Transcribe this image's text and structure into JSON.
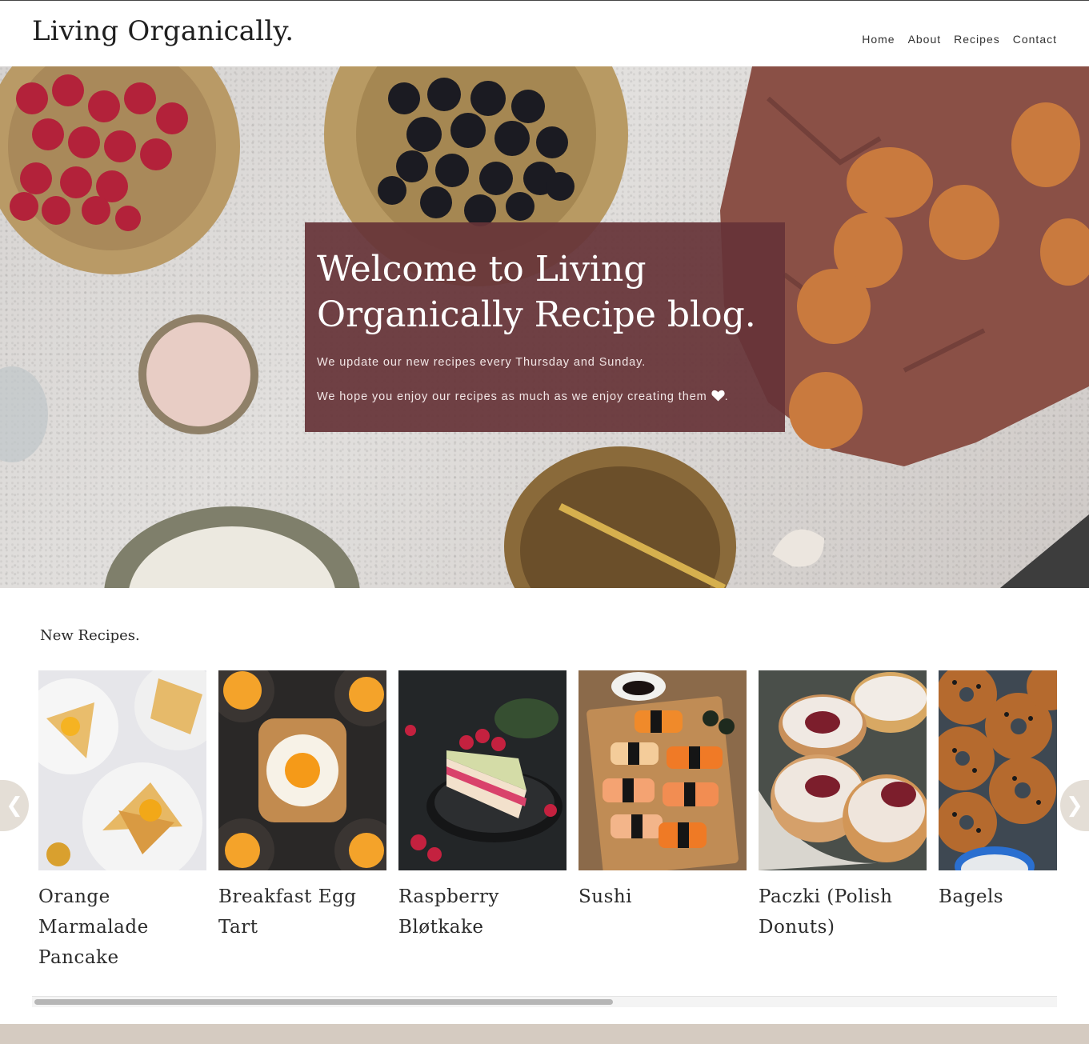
{
  "header": {
    "site_title": "Living Organically.",
    "nav": [
      "Home",
      "About",
      "Recipes",
      "Contact"
    ]
  },
  "hero": {
    "title": "Welcome to Living Organically Recipe blog.",
    "line1": "We update our new recipes every Thursday and Sunday.",
    "line2": "We hope you enjoy our recipes as much as we enjoy creating them",
    "line2_end": ".",
    "heart_icon": "heart-icon",
    "box_color": "#663438"
  },
  "recipes": {
    "title": "New Recipes.",
    "items": [
      {
        "name": "Orange Marmalade Pancake"
      },
      {
        "name": "Breakfast Egg Tart"
      },
      {
        "name": "Raspberry Bløtkake"
      },
      {
        "name": "Sushi"
      },
      {
        "name": "Paczki (Polish Donuts)"
      },
      {
        "name": "Bagels"
      }
    ],
    "prev_icon": "❮",
    "next_icon": "❯",
    "scroll_fraction": 0.56
  },
  "colors": {
    "accent": "#663438",
    "footer": "#d5cbc1"
  }
}
